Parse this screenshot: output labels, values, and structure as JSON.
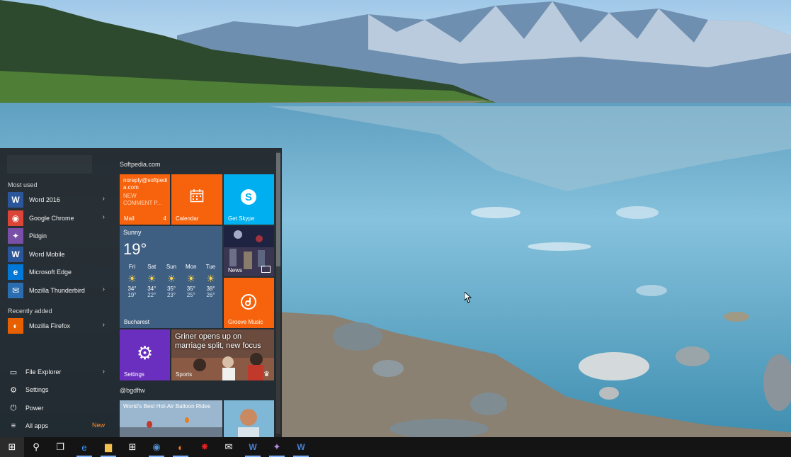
{
  "start_menu": {
    "most_used_label": "Most used",
    "most_used": [
      {
        "label": "Word 2016",
        "icon": "word-icon",
        "color": "#2b579a",
        "glyph": "W",
        "has_submenu": true
      },
      {
        "label": "Google Chrome",
        "icon": "chrome-icon",
        "color": "#db4437",
        "glyph": "◉",
        "has_submenu": true
      },
      {
        "label": "Pidgin",
        "icon": "pidgin-icon",
        "color": "#7a4fa8",
        "glyph": "✦",
        "has_submenu": false
      },
      {
        "label": "Word Mobile",
        "icon": "word-mobile-icon",
        "color": "#2b579a",
        "glyph": "W",
        "has_submenu": false
      },
      {
        "label": "Microsoft Edge",
        "icon": "edge-icon",
        "color": "#0078d7",
        "glyph": "e",
        "has_submenu": false
      },
      {
        "label": "Mozilla Thunderbird",
        "icon": "thunderbird-icon",
        "color": "#2a6db0",
        "glyph": "✉",
        "has_submenu": true
      }
    ],
    "recently_added_label": "Recently added",
    "recently_added": [
      {
        "label": "Mozilla Firefox",
        "icon": "firefox-icon",
        "color": "#e66000",
        "glyph": "◐",
        "has_submenu": true
      }
    ],
    "system": [
      {
        "label": "File Explorer",
        "icon": "file-explorer-icon",
        "glyph": "▭",
        "has_submenu": true
      },
      {
        "label": "Settings",
        "icon": "gear-icon",
        "glyph": "⚙"
      },
      {
        "label": "Power",
        "icon": "power-icon",
        "glyph": "⏻"
      },
      {
        "label": "All apps",
        "icon": "all-apps-icon",
        "glyph": "≡",
        "badge": "New"
      }
    ]
  },
  "tiles": {
    "section1": "Softpedia.com",
    "mail": {
      "from": "noreply@softpedia.com",
      "line1": "NEW",
      "line2": "COMMENT P...",
      "name": "Mail",
      "count": "4",
      "color": "#f7630c"
    },
    "calendar": {
      "name": "Calendar",
      "color": "#f7630c"
    },
    "skype": {
      "name": "Get Skype",
      "color": "#00aff0"
    },
    "weather": {
      "condition": "Sunny",
      "temp": "19°",
      "city": "Bucharest",
      "days": [
        {
          "d": "Fri",
          "hi": "34°",
          "lo": "19°"
        },
        {
          "d": "Sat",
          "hi": "34°",
          "lo": "22°"
        },
        {
          "d": "Sun",
          "hi": "35°",
          "lo": "23°"
        },
        {
          "d": "Mon",
          "hi": "35°",
          "lo": "25°"
        },
        {
          "d": "Tue",
          "hi": "38°",
          "lo": "26°"
        }
      ]
    },
    "news": {
      "name": "News"
    },
    "groove": {
      "name": "Groove Music",
      "color": "#f7630c"
    },
    "settings": {
      "name": "Settings",
      "color": "#6b2fbf"
    },
    "sports": {
      "headline": "Griner opens up on marriage split, new focus",
      "name": "Sports"
    },
    "section2": "@bgdftw",
    "balloon": {
      "headline": "World's Best Hot-Air Balloon Rides"
    }
  },
  "taskbar": [
    {
      "name": "start-button",
      "glyph": "⊞",
      "color": "#ffffff"
    },
    {
      "name": "search-button",
      "glyph": "⚲",
      "color": "#ffffff"
    },
    {
      "name": "task-view-button",
      "glyph": "❐",
      "color": "#ffffff"
    },
    {
      "name": "edge-taskbar",
      "glyph": "e",
      "color": "#3a9bff"
    },
    {
      "name": "file-explorer-taskbar",
      "glyph": "▆",
      "color": "#f2c14e"
    },
    {
      "name": "store-taskbar",
      "glyph": "⊞",
      "color": "#ffffff"
    },
    {
      "name": "thunderbird-taskbar",
      "glyph": "◉",
      "color": "#4f8fd1"
    },
    {
      "name": "firefox-taskbar",
      "glyph": "◐",
      "color": "#ff7b1c"
    },
    {
      "name": "star-app-taskbar",
      "glyph": "✸",
      "color": "#e02020"
    },
    {
      "name": "mail-taskbar",
      "glyph": "✉",
      "color": "#ffffff"
    },
    {
      "name": "word-taskbar",
      "glyph": "W",
      "color": "#4a7fd1"
    },
    {
      "name": "pidgin-taskbar",
      "glyph": "✦",
      "color": "#b58ee6"
    },
    {
      "name": "word-mobile-taskbar",
      "glyph": "W",
      "color": "#4a7fd1"
    }
  ]
}
